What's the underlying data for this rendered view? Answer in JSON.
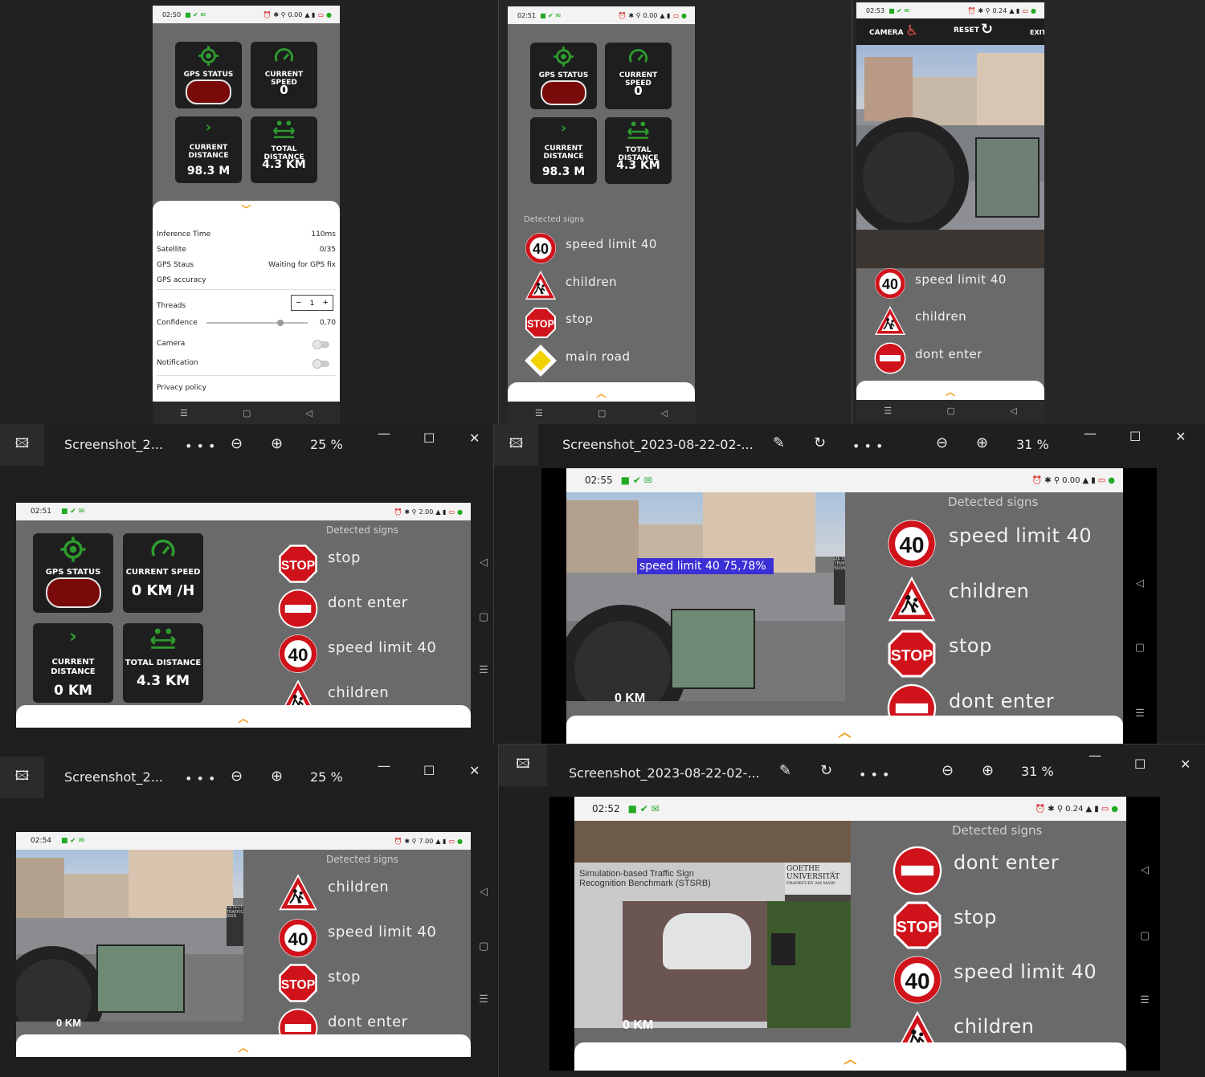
{
  "windows": {
    "w1": {
      "time": "02:50"
    },
    "w2": {
      "time": "02:51"
    },
    "w3": {
      "time": "02:53"
    },
    "w4": {
      "title": "Screenshot_2...",
      "zoom": "25 %",
      "time": "02:51"
    },
    "w5": {
      "title": "Screenshot_2023-08-22-02-...",
      "zoom": "31 %",
      "time": "02:55"
    },
    "w6": {
      "title": "Screenshot_2...",
      "zoom": "25 %",
      "time": "02:54"
    },
    "w7": {
      "title": "Screenshot_2023-08-22-02-...",
      "zoom": "31 %",
      "time": "02:52"
    }
  },
  "toolbar": {
    "more": "• • •"
  },
  "status_speeds": {
    "w1": "0.00",
    "w2": "0.00",
    "w3": "0.24",
    "w4": "2.00",
    "w5": "0.00",
    "w6": "7.00",
    "w7": "0.24"
  },
  "dashboard": {
    "gps_status": "GPS STATUS",
    "current_speed": "CURRENT SPEED",
    "current_distance": "CURRENT DISTANCE",
    "total_distance": "TOTAL DISTANCE",
    "speed_value": "0",
    "speed_value_kmh": "0  KM /H",
    "current_distance_value": "98.3 M",
    "current_distance_value_km": "0 KM",
    "total_distance_value": "4.3 KM"
  },
  "settings": {
    "inference_label": "Inference Time",
    "inference_value": "110ms",
    "satellite_label": "Satellite",
    "satellite_value": "0/35",
    "gps_status_label": "GPS Staus",
    "gps_status_value": "Waiting for GPS fix",
    "gps_accuracy_label": "GPS accuracy",
    "threads_label": "Threads",
    "threads_value": "1",
    "confidence_label": "Confidence",
    "confidence_value": "0,70",
    "confidence_fraction": 0.7,
    "camera_label": "Camera",
    "notification_label": "Notification",
    "privacy_label": "Privacy policy"
  },
  "detected_signs_label": "Detected signs",
  "signs": {
    "speed": "speed limit 40",
    "children": "children",
    "stop": "stop",
    "main_road": "main road",
    "dont_enter": "dont enter"
  },
  "sign_glyphs": {
    "speed": "40",
    "stop": "STOP"
  },
  "camera_bar": {
    "camera": "CAMERA",
    "reset": "RESET",
    "exit": "EXIT"
  },
  "detection_box": "speed limit 40 75,78%",
  "scene_text": {
    "poster_title": "Simulation-based Traffic Sign Recognition Benchmark (STSRB)",
    "university": "GOETHE UNIVERSITÄT",
    "university_sub": "FRANKFURT AM MAIN",
    "detect_label": "DETECT TRAFFIC SIGN",
    "odometer": "0 KM"
  },
  "colors": {
    "accent": "#f29a14",
    "icon_green": "#2e9c2e",
    "sign_red": "#d0121b",
    "gps_red": "#7a0a0a",
    "detect_blue": "#3b2fd6"
  }
}
